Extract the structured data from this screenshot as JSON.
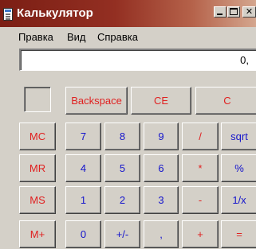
{
  "window": {
    "title": "Калькулятор"
  },
  "menu": {
    "items": [
      "Правка",
      "Вид",
      "Справка"
    ]
  },
  "display": {
    "value": "0,"
  },
  "colors": {
    "title_gradient_start": "#7b1e14",
    "title_gradient_end": "#d4a68e",
    "face": "#d4d0c8",
    "red_label": "#e02020",
    "blue_label": "#1414cc"
  },
  "buttons": {
    "backspace": "Backspace",
    "ce": "CE",
    "c": "C",
    "mc": "MC",
    "mr": "MR",
    "ms": "MS",
    "mplus": "M+",
    "d7": "7",
    "d8": "8",
    "d9": "9",
    "d4": "4",
    "d5": "5",
    "d6": "6",
    "d1": "1",
    "d2": "2",
    "d3": "3",
    "d0": "0",
    "sign": "+/-",
    "decimal": ",",
    "divide": "/",
    "multiply": "*",
    "subtract": "-",
    "add": "+",
    "sqrt": "sqrt",
    "percent": "%",
    "reciprocal": "1/x",
    "equals": "="
  }
}
